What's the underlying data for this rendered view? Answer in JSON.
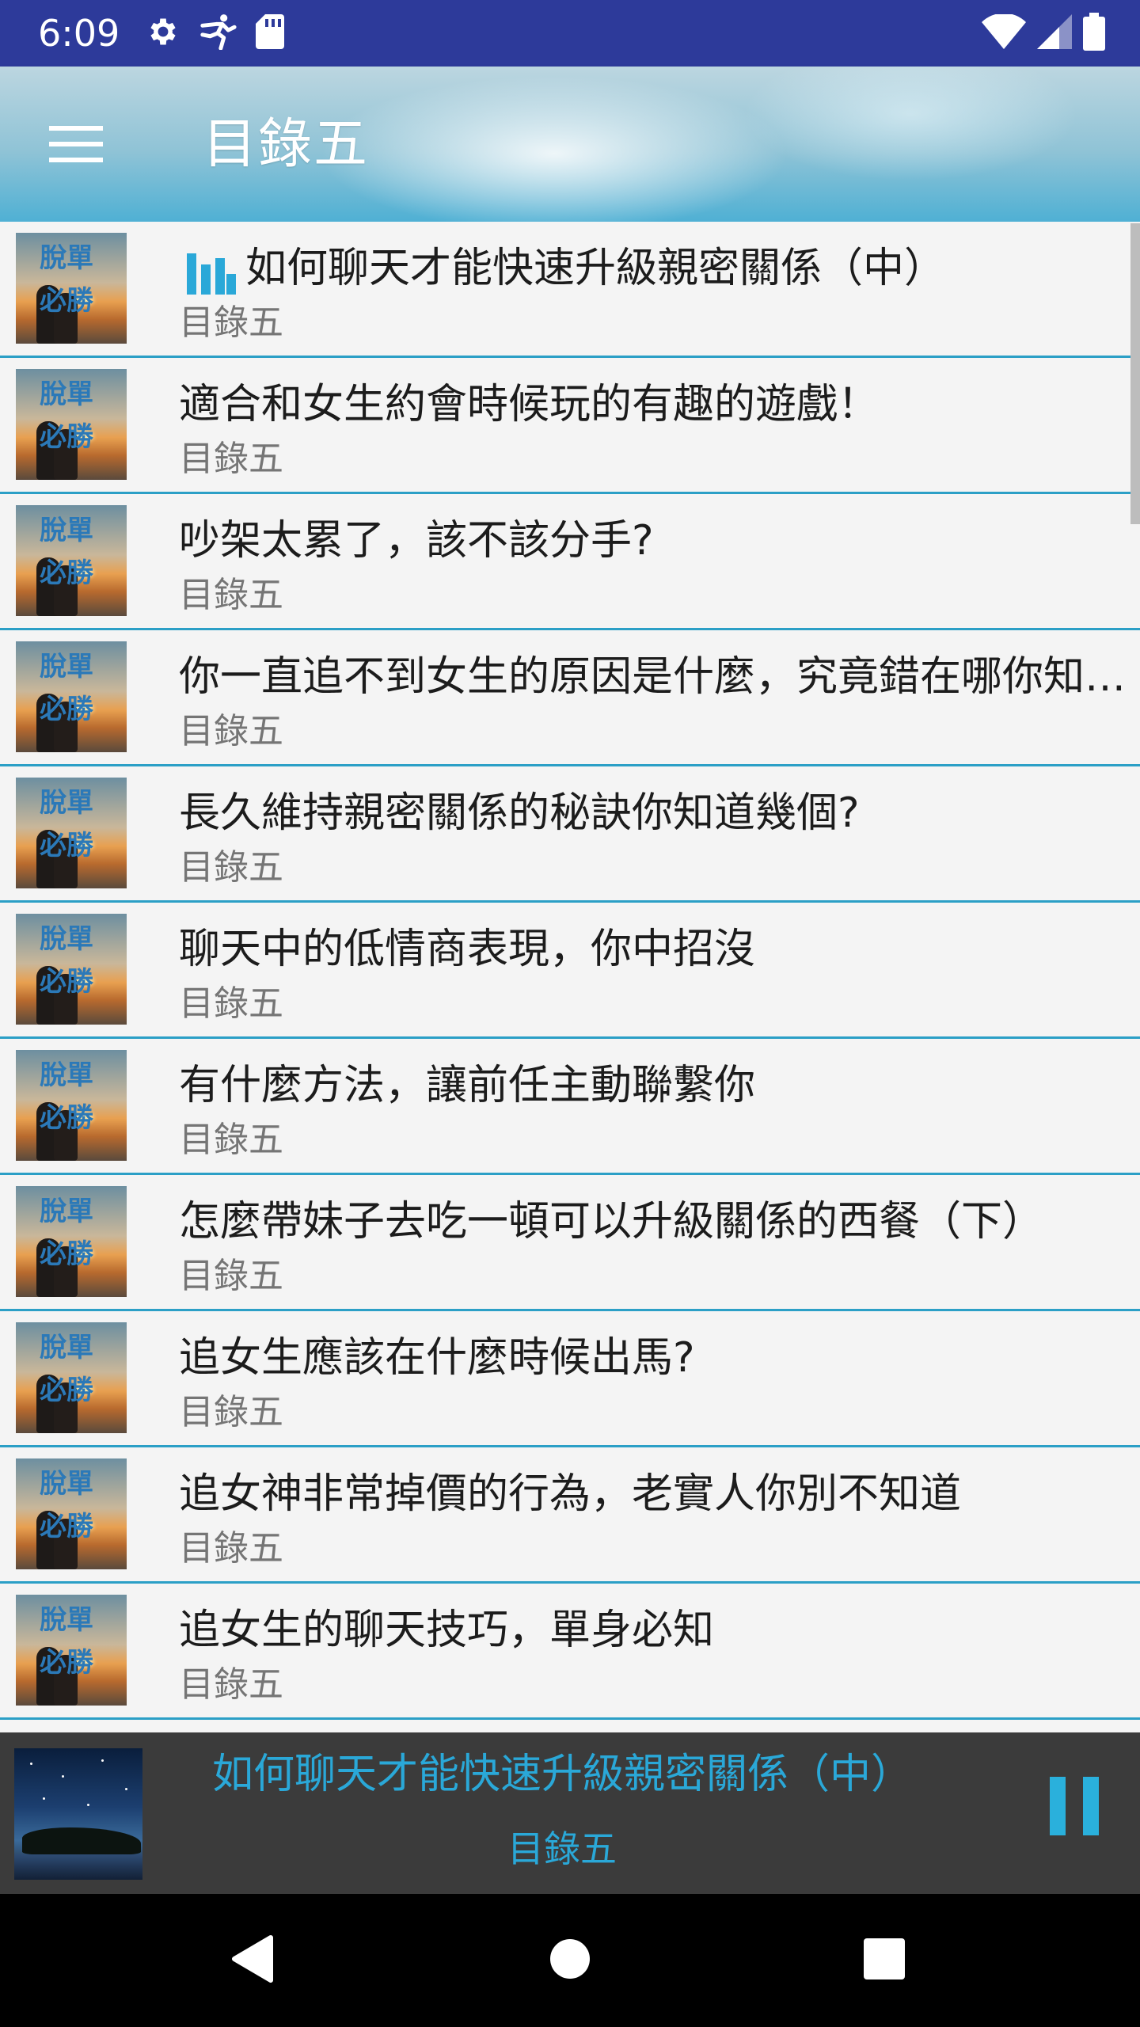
{
  "status_bar": {
    "time": "6:09",
    "left_icons": [
      "gear-icon",
      "running-figure-icon",
      "sd-card-icon"
    ],
    "right_icons": [
      "wifi-icon",
      "cell-signal-icon",
      "battery-icon"
    ]
  },
  "app_bar": {
    "menu_icon": "menu-icon",
    "title": "目錄五"
  },
  "list": {
    "thumbnail_text_line1": "脫單",
    "thumbnail_text_line2": "必勝",
    "items": [
      {
        "title": "如何聊天才能快速升級親密關係（中）",
        "subtitle": "目錄五",
        "playing": true
      },
      {
        "title": "適合和女生約會時候玩的有趣的遊戲！",
        "subtitle": "目錄五"
      },
      {
        "title": "吵架太累了，該不該分手?",
        "subtitle": "目錄五"
      },
      {
        "title": "你一直追不到女生的原因是什麼，究竟錯在哪你知道嗎?",
        "subtitle": "目錄五"
      },
      {
        "title": "長久維持親密關係的秘訣你知道幾個?",
        "subtitle": "目錄五"
      },
      {
        "title": "聊天中的低情商表現，你中招沒",
        "subtitle": "目錄五"
      },
      {
        "title": "有什麼方法，讓前任主動聯繫你",
        "subtitle": "目錄五"
      },
      {
        "title": "怎麼帶妹子去吃一頓可以升級關係的西餐（下）",
        "subtitle": "目錄五"
      },
      {
        "title": "追女生應該在什麼時候出馬?",
        "subtitle": "目錄五"
      },
      {
        "title": "追女神非常掉價的行為，老實人你別不知道",
        "subtitle": "目錄五"
      },
      {
        "title": "追女生的聊天技巧，單身必知",
        "subtitle": "目錄五"
      }
    ]
  },
  "now_playing": {
    "title": "如何聊天才能快速升級親密關係（中）",
    "subtitle": "目錄五",
    "control_icon": "pause-icon",
    "accent_color": "#2aa8d8"
  },
  "nav_bar": {
    "icons": [
      "back-icon",
      "home-icon",
      "recents-icon"
    ]
  },
  "colors": {
    "status_bar": "#2d3a9a",
    "divider": "#2b9fc6",
    "list_background": "#f4f4f4",
    "player_background": "#3b3b3b"
  }
}
